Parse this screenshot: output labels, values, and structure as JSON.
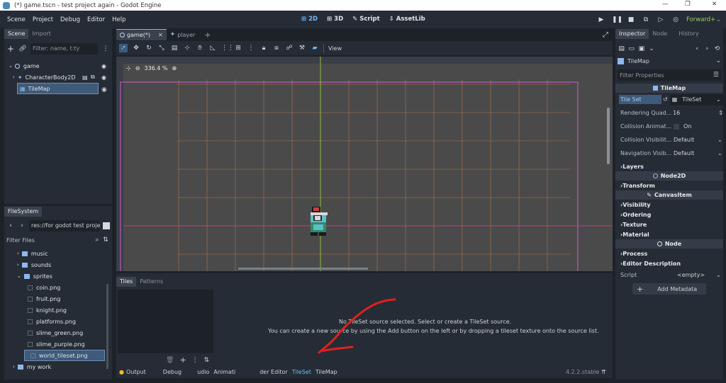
{
  "window": {
    "title": "(*) game.tscn - test project again - Godot Engine",
    "min": "—",
    "max": "❐",
    "close": "✕"
  },
  "menu": {
    "items": [
      "Scene",
      "Project",
      "Debug",
      "Editor",
      "Help"
    ]
  },
  "workspaces": {
    "b2d": "2D",
    "b3d": "3D",
    "script": "Script",
    "assetlib": "AssetLib"
  },
  "renderer": "Forward+",
  "scene_dock": {
    "tabs": [
      "Scene",
      "Import"
    ],
    "filter_placeholder": "Filter: name, t:ty",
    "nodes": [
      {
        "label": "game"
      },
      {
        "label": "CharacterBody2D"
      },
      {
        "label": "TileMap"
      }
    ]
  },
  "fs_dock": {
    "tab": "FileSystem",
    "path": "res://for godot test project/s",
    "filter_placeholder": "Filter Files",
    "items": [
      {
        "label": "music",
        "type": "folder"
      },
      {
        "label": "sounds",
        "type": "folder"
      },
      {
        "label": "sprites",
        "type": "folder"
      },
      {
        "label": "coin.png",
        "type": "file"
      },
      {
        "label": "fruit.png",
        "type": "file"
      },
      {
        "label": "knight.png",
        "type": "file"
      },
      {
        "label": "platforms.png",
        "type": "file"
      },
      {
        "label": "slime_green.png",
        "type": "file"
      },
      {
        "label": "slime_purple.png",
        "type": "file"
      },
      {
        "label": "world_tileset.png",
        "type": "file"
      },
      {
        "label": "my work",
        "type": "folder"
      }
    ]
  },
  "editor_tabs": [
    "game(*)",
    "player"
  ],
  "viewport": {
    "zoom": "336.4 %",
    "view_label": "View"
  },
  "bottom": {
    "tabs": [
      "Tiles",
      "Patterns"
    ],
    "message1": "No TileSet source selected. Select or create a TileSet source.",
    "message2": "You can create a new source by using the Add button on the left or by dropping a tileset texture onto the source list.",
    "bar_items": [
      "Output",
      "Debug",
      "udio",
      "Animati",
      "der Editor",
      "TileSet",
      "TileMap"
    ],
    "version": "4.2.2.stable"
  },
  "inspector": {
    "tabs": [
      "Inspector",
      "Node",
      "History"
    ],
    "node_name": "TileMap",
    "filter_placeholder": "Filter Properties",
    "class_header": "TileMap",
    "props": [
      {
        "label": "Tile Set",
        "value": "TileSet"
      },
      {
        "label": "Rendering Quad...",
        "value": "16"
      },
      {
        "label": "Collision Animat...",
        "value": "On"
      },
      {
        "label": "Collision Visibilit...",
        "value": "Default"
      },
      {
        "label": "Navigation Visib...",
        "value": "Default"
      }
    ],
    "layers": "Layers",
    "node2d": "Node2D",
    "transform": "Transform",
    "canvasitem": "CanvasItem",
    "ci_sections": [
      "Visibility",
      "Ordering",
      "Texture",
      "Material"
    ],
    "node": "Node",
    "node_sections": [
      "Process",
      "Editor Description"
    ],
    "script_label": "Script",
    "script_value": "<empty>",
    "add_metadata": "Add Metadata"
  },
  "colors": {
    "accent": "#70bafa",
    "selection": "#3f5a7a",
    "grid": "#c37c48",
    "canvas": "#4a4a4a",
    "pink": "#d05ed6",
    "annotation": "#e0201c"
  }
}
